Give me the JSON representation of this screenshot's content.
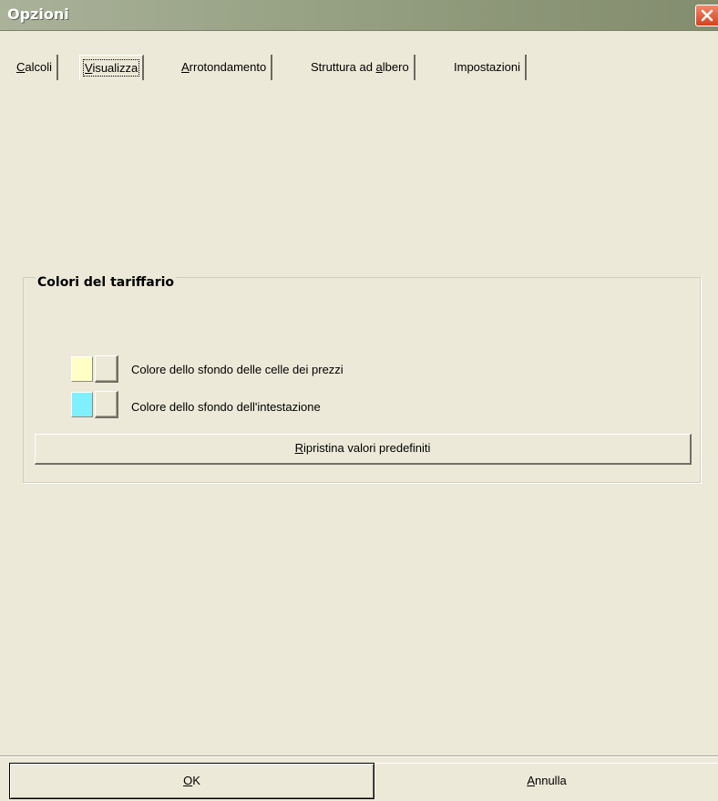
{
  "window": {
    "title": "Opzioni"
  },
  "tabs": [
    {
      "pre": "",
      "mn": "C",
      "post": "alcoli"
    },
    {
      "pre": "",
      "mn": "V",
      "post": "isualizza",
      "selected": true
    },
    {
      "pre": "",
      "mn": "A",
      "post": "rrotondamento"
    },
    {
      "pre": "Struttura ad ",
      "mn": "a",
      "post": "lbero"
    },
    {
      "pre": "Impostazioni",
      "mn": "",
      "post": ""
    }
  ],
  "group": {
    "title": "Colori del tariffario",
    "price_cells_color": {
      "label": "Colore dello sfondo delle celle dei prezzi",
      "color": "#ffffc5"
    },
    "header_color": {
      "label": "Colore dello sfondo dell'intestazione",
      "color": "#7ff0ff"
    },
    "reset": {
      "mn": "R",
      "post": "ipristina valori predefiniti"
    }
  },
  "buttons": {
    "ok": {
      "mn": "O",
      "post": "K"
    },
    "cancel": {
      "mn": "A",
      "post": "nnulla"
    }
  }
}
